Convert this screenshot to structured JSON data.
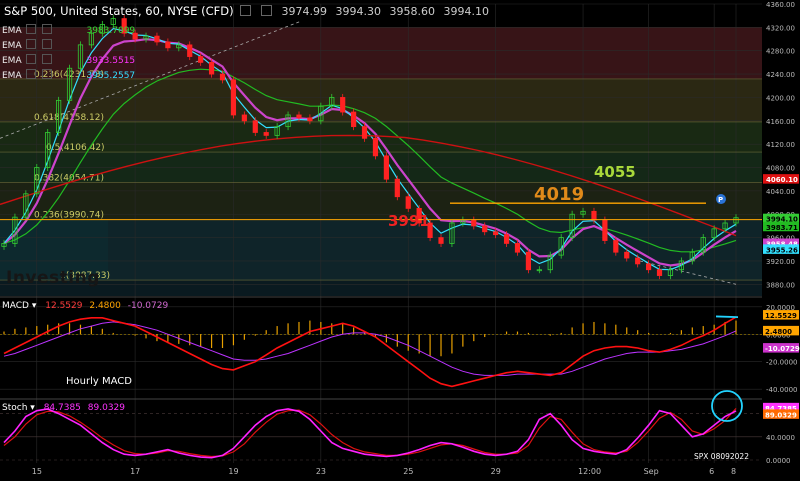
{
  "header": {
    "symbol": "S&P 500, United States, 60, NYSE (CFD)",
    "open": "3974.99",
    "high": "3994.30",
    "low": "3958.60",
    "close": "3994.10"
  },
  "ema_rows": [
    {
      "label": "EMA",
      "value": "3983.7099",
      "color": "#33dd33"
    },
    {
      "label": "EMA",
      "value": "",
      "color": "#ff66ff"
    },
    {
      "label": "EMA",
      "value": "3933.5515",
      "color": "#ff33ff"
    },
    {
      "label": "EMA",
      "value": "3955.2557",
      "color": "#33e0ff"
    }
  ],
  "annotations": {
    "level_3991": "3991",
    "level_4019": "4019",
    "level_4055": "4055",
    "hourly_macd": "Hourly MACD",
    "watermark": "Investing",
    "stamp": "SPX 08092022"
  },
  "colors": {
    "background": "#000000",
    "up_candle": "#33cc33",
    "down_candle": "#ff2222",
    "ema_fast": "#33e0ff",
    "ema_mid": "#cc44cc",
    "ema_slow": "#22bb22",
    "ema_long": "#cc1111",
    "fib_line": "#ffa500",
    "macd_line": "#ff1111",
    "signal_line": "#bb33ff",
    "hist": "#e8a000",
    "stoch_k": "#ff22ff",
    "stoch_d": "#dd1111",
    "highlight": "#22d3ff"
  },
  "chart_data": [
    {
      "type": "line",
      "title": "S&P 500, United States, 60, NYSE (CFD)",
      "xlabel": "",
      "ylabel": "",
      "ylim": [
        3860,
        4360
      ],
      "y_ticks": [
        "4360.00",
        "4320.00",
        "4280.00",
        "4240.00",
        "4200.00",
        "4160.00",
        "4120.00",
        "4080.00",
        "4040.00",
        "4000.00",
        "3960.00",
        "3920.00",
        "3880.00"
      ],
      "x_ticks": [
        "15",
        "17",
        "19",
        "23",
        "25",
        "29",
        "12:00",
        "Sep",
        "6",
        "8"
      ],
      "fib_levels": [
        {
          "label": "0.236(4231.73)",
          "value": 4231.73
        },
        {
          "label": "0.618(4158.12)",
          "value": 4158.12
        },
        {
          "label": "0.5(4106.42)",
          "value": 4106.42
        },
        {
          "label": "0.382(4054.71)",
          "value": 4054.71
        },
        {
          "label": "0.236(3990.74)",
          "value": 3990.74
        },
        {
          "label": "1(3887.33)",
          "value": 3887.33
        }
      ],
      "price_badges": [
        {
          "value": "4060.10",
          "color": "#dd1111"
        },
        {
          "value": "3994.10",
          "color": "#33cc33"
        },
        {
          "value": "3983.71",
          "color": "#22bb22"
        },
        {
          "value": "3958.48",
          "color": "#cc44cc"
        },
        {
          "value": "3955.26",
          "color": "#33e0ff"
        }
      ],
      "horizontal_levels": [
        3991,
        4019
      ],
      "series": [
        {
          "name": "Close",
          "values": [
            3950,
            3995,
            4035,
            4080,
            4140,
            4195,
            4250,
            4290,
            4310,
            4325,
            4335,
            4310,
            4300,
            4305,
            4295,
            4285,
            4290,
            4270,
            4260,
            4240,
            4230,
            4170,
            4160,
            4140,
            4135,
            4150,
            4170,
            4165,
            4160,
            4185,
            4200,
            4175,
            4150,
            4130,
            4100,
            4060,
            4030,
            4010,
            3985,
            3960,
            3950,
            3985,
            3990,
            3980,
            3970,
            3965,
            3950,
            3935,
            3905,
            3905,
            3930,
            3960,
            4000,
            4005,
            3990,
            3955,
            3935,
            3925,
            3915,
            3905,
            3895,
            3905,
            3920,
            3935,
            3960,
            3975,
            3985,
            3994
          ]
        }
      ]
    },
    {
      "type": "line",
      "title": "MACD",
      "values_label": [
        "12.5529",
        "2.4800",
        "-10.0729"
      ],
      "ylim": [
        -45,
        25
      ],
      "y_ticks": [
        "20.0000",
        "0.0000",
        "-20.0000",
        "-40.0000"
      ],
      "series": [
        {
          "name": "MACD",
          "values": [
            -14,
            -10,
            -6,
            -2,
            2,
            6,
            9,
            11,
            12,
            12,
            10,
            8,
            6,
            2,
            -2,
            -6,
            -10,
            -14,
            -18,
            -22,
            -25,
            -26,
            -23,
            -20,
            -15,
            -10,
            -6,
            -2,
            2,
            4,
            6,
            8,
            6,
            2,
            -2,
            -8,
            -14,
            -20,
            -26,
            -32,
            -36,
            -38,
            -36,
            -34,
            -32,
            -30,
            -28,
            -27,
            -28,
            -29,
            -30,
            -28,
            -22,
            -16,
            -12,
            -10,
            -9,
            -9,
            -10,
            -12,
            -13,
            -11,
            -8,
            -4,
            -1,
            3,
            8,
            12.5
          ]
        },
        {
          "name": "Signal",
          "values": [
            -16,
            -14,
            -11,
            -8,
            -5,
            -2,
            1,
            4,
            6,
            8,
            9,
            8,
            7,
            5,
            3,
            0,
            -3,
            -6,
            -9,
            -12,
            -15,
            -18,
            -19,
            -19,
            -18,
            -16,
            -14,
            -11,
            -8,
            -5,
            -2,
            0,
            1,
            1,
            0,
            -2,
            -5,
            -8,
            -12,
            -16,
            -20,
            -24,
            -27,
            -29,
            -30,
            -30,
            -30,
            -29,
            -29,
            -29,
            -29,
            -29,
            -27,
            -24,
            -21,
            -18,
            -16,
            -14,
            -13,
            -13,
            -13,
            -12,
            -11,
            -9,
            -7,
            -4,
            -1,
            2.5
          ]
        },
        {
          "name": "Histogram",
          "values": [
            2,
            4,
            5,
            6,
            7,
            8,
            8,
            7,
            6,
            4,
            1,
            0,
            -1,
            -3,
            -5,
            -6,
            -7,
            -8,
            -9,
            -10,
            -10,
            -8,
            -4,
            -1,
            3,
            6,
            8,
            9,
            10,
            9,
            8,
            8,
            5,
            1,
            -2,
            -6,
            -9,
            -12,
            -14,
            -16,
            -16,
            -14,
            -9,
            -5,
            -2,
            0,
            2,
            2,
            1,
            0,
            -1,
            1,
            5,
            8,
            9,
            8,
            7,
            5,
            3,
            1,
            0,
            1,
            3,
            5,
            6,
            7,
            9,
            10
          ]
        }
      ]
    },
    {
      "type": "line",
      "title": "Stoch",
      "values_label": [
        "84.7385",
        "89.0329"
      ],
      "ylim": [
        0,
        100
      ],
      "y_ticks": [
        "80.0000",
        "40.0000",
        "0.0000"
      ],
      "series": [
        {
          "name": "%K",
          "values": [
            30,
            50,
            75,
            85,
            88,
            80,
            70,
            60,
            45,
            30,
            18,
            10,
            8,
            10,
            14,
            18,
            12,
            8,
            5,
            4,
            8,
            20,
            40,
            60,
            75,
            85,
            88,
            84,
            70,
            50,
            30,
            20,
            15,
            10,
            8,
            6,
            8,
            12,
            18,
            25,
            30,
            28,
            22,
            15,
            10,
            8,
            10,
            15,
            35,
            70,
            80,
            60,
            35,
            20,
            15,
            12,
            10,
            18,
            38,
            60,
            85,
            80,
            60,
            40,
            45,
            60,
            75,
            84.7
          ]
        },
        {
          "name": "%D",
          "values": [
            25,
            40,
            62,
            78,
            84,
            83,
            76,
            65,
            52,
            38,
            26,
            16,
            11,
            10,
            12,
            16,
            15,
            11,
            8,
            6,
            7,
            14,
            28,
            48,
            65,
            79,
            85,
            86,
            78,
            62,
            44,
            30,
            20,
            14,
            11,
            8,
            8,
            10,
            14,
            20,
            26,
            28,
            25,
            19,
            13,
            10,
            10,
            12,
            25,
            55,
            75,
            70,
            48,
            28,
            18,
            14,
            12,
            15,
            30,
            50,
            72,
            82,
            70,
            50,
            44,
            54,
            68,
            89.0
          ]
        }
      ]
    }
  ]
}
